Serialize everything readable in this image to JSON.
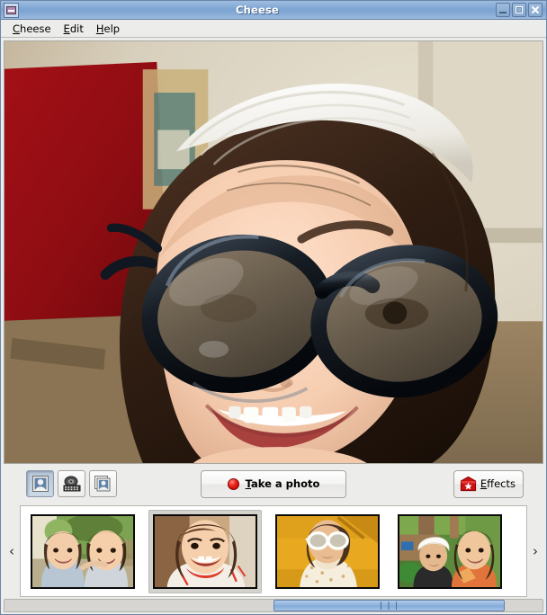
{
  "window": {
    "title": "Cheese",
    "app_icon": "cheese-app-icon",
    "buttons": {
      "minimize": "minimize-icon",
      "maximize": "maximize-icon",
      "close": "close-icon"
    }
  },
  "menubar": {
    "items": [
      {
        "label": "Cheese",
        "mnemonic": "C"
      },
      {
        "label": "Edit",
        "mnemonic": "E"
      },
      {
        "label": "Help",
        "mnemonic": "H"
      }
    ]
  },
  "viewfinder": {
    "description": "Live webcam preview: smiling toddler wearing oversized dark sunglasses and a white headband, red chair and beige wall behind."
  },
  "toolbar": {
    "modes": [
      {
        "name": "photo-mode",
        "icon": "photo-icon",
        "active": true
      },
      {
        "name": "video-mode",
        "icon": "film-reel-icon",
        "active": false
      },
      {
        "name": "burst-mode",
        "icon": "burst-photos-icon",
        "active": false
      }
    ],
    "take_photo": {
      "label": "Take a photo",
      "mnemonic": "T",
      "icon": "record-dot-icon"
    },
    "effects": {
      "label": "Effects",
      "mnemonic": "E",
      "icon": "effects-toolbox-icon"
    }
  },
  "thumbnails": {
    "prev_arrow": "‹",
    "next_arrow": "›",
    "items": [
      {
        "name": "thumb-two-girls-outdoors",
        "selected": false
      },
      {
        "name": "thumb-laughing-girl-red-shirt",
        "selected": true
      },
      {
        "name": "thumb-girl-white-sunglasses",
        "selected": false
      },
      {
        "name": "thumb-two-sisters-outdoors",
        "selected": false
      }
    ]
  },
  "scrollbar": {
    "name": "thumbnail-scrollbar",
    "grip": "❘❘❘",
    "thumb_left_pct": 50,
    "thumb_width_pct": 43
  },
  "colors": {
    "titlebar_start": "#9fbde0",
    "titlebar_end": "#9abade",
    "chrome": "#ececeb",
    "accent_blue": "#8fb3de",
    "record_red": "#ee1b14",
    "effects_red": "#cc1111"
  }
}
